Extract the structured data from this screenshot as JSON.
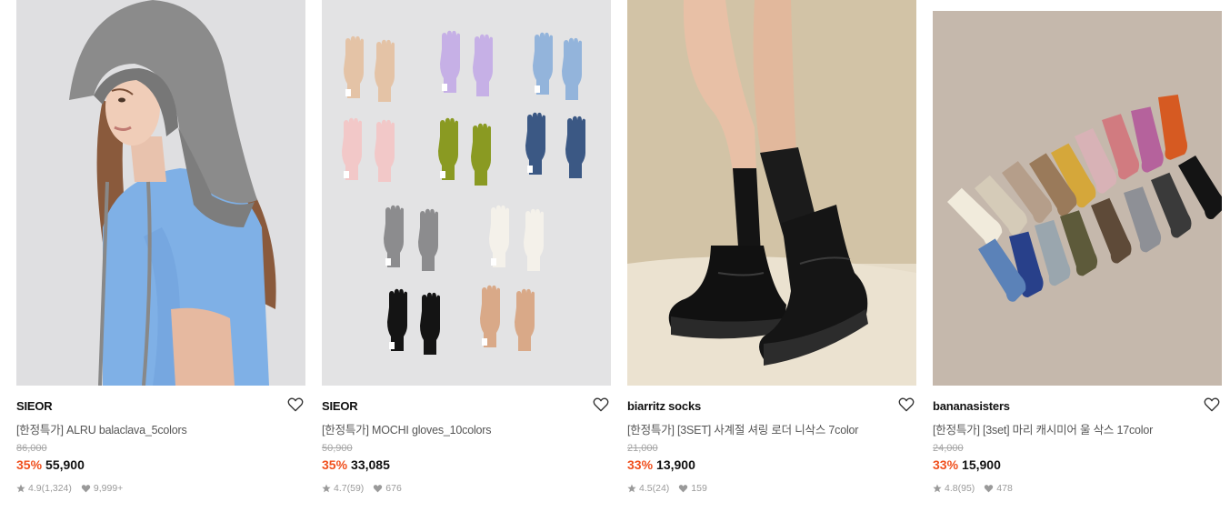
{
  "products": [
    {
      "brand": "SIEOR",
      "name": "[한정특가] ALRU balaclava_5colors",
      "original_price": "86,000",
      "discount": "35%",
      "price": "55,900",
      "rating": "4.9",
      "reviews": "(1,324)",
      "likes": "9,999+"
    },
    {
      "brand": "SIEOR",
      "name": "[한정특가] MOCHI gloves_10colors",
      "original_price": "50,900",
      "discount": "35%",
      "price": "33,085",
      "rating": "4.7",
      "reviews": "(59)",
      "likes": "676"
    },
    {
      "brand": "biarritz socks",
      "name": "[한정특가] [3SET] 사계절 셔링 로더 니삭스 7color",
      "original_price": "21,000",
      "discount": "33%",
      "price": "13,900",
      "rating": "4.5",
      "reviews": "(24)",
      "likes": "159"
    },
    {
      "brand": "bananasisters",
      "name": "[한정특가] [3set] 마리 캐시미어 울 삭스 17color",
      "original_price": "24,000",
      "discount": "33%",
      "price": "15,900",
      "rating": "4.8",
      "reviews": "(95)",
      "likes": "478"
    }
  ],
  "colors": {
    "discount": "#f0501e",
    "original_price": "#a4a4a4",
    "meta": "#9a9a9a"
  },
  "icons": {
    "wishlist": "heart-outline-icon",
    "rating": "star-icon",
    "likes": "heart-filled-icon"
  }
}
